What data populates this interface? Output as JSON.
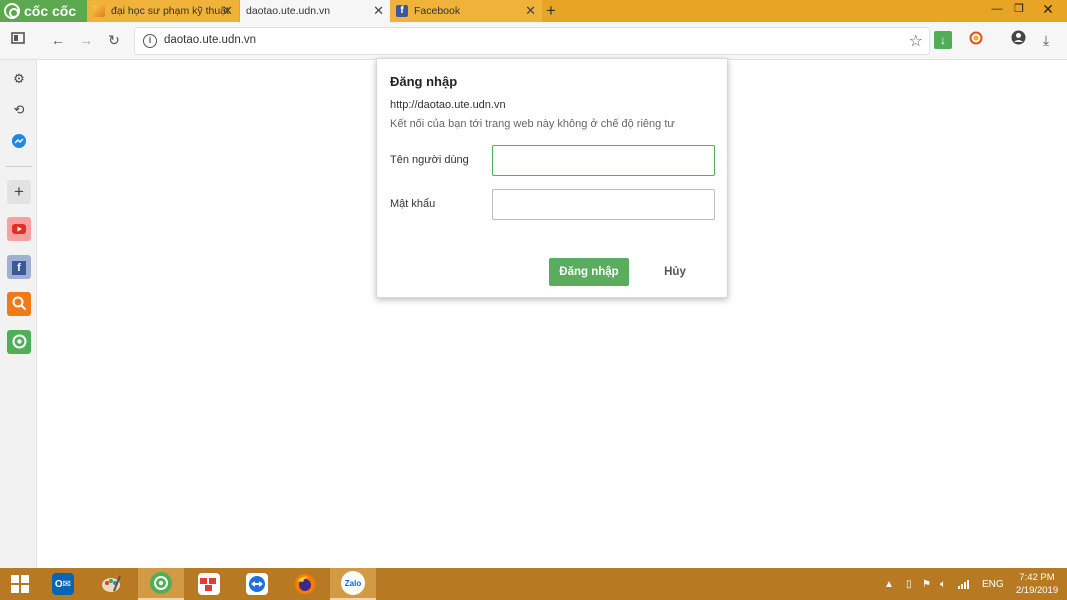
{
  "browser": {
    "brand": "cốc cốc",
    "tabs": [
      {
        "title": "đại học sư phạm kỹ thuật",
        "active": false,
        "favicon": "coccoc-leaf-icon"
      },
      {
        "title": "daotao.ute.udn.vn",
        "active": true,
        "favicon": ""
      },
      {
        "title": "Facebook",
        "active": false,
        "favicon": "facebook-icon"
      }
    ],
    "new_tab": "+",
    "address": "daotao.ute.udn.vn"
  },
  "sidebar": {
    "items": [
      "settings-icon",
      "history-icon",
      "messenger-icon",
      "add-icon",
      "youtube-icon",
      "facebook-icon",
      "search-icon",
      "coccoc-icon"
    ]
  },
  "dialog": {
    "title": "Đăng nhập",
    "url": "http://daotao.ute.udn.vn",
    "warning": "Kết nối của bạn tới trang web này không ở chế độ riêng tư",
    "username_label": "Tên người dùng",
    "username_value": "",
    "password_label": "Mật khẩu",
    "password_value": "",
    "login_button": "Đăng nhập",
    "cancel_button": "Hủy"
  },
  "taskbar": {
    "language": "ENG",
    "time": "7:42 PM",
    "date": "2/19/2019",
    "apps": [
      "windows-start-icon",
      "outlook-icon",
      "paint-icon",
      "coccoc-icon",
      "teamviewer-meeting-icon",
      "teamviewer-icon",
      "firefox-icon",
      "zalo-icon"
    ],
    "zalo_label": "Zalo"
  },
  "colors": {
    "tabstrip": "#e8a424",
    "brand_green": "#5ba84f",
    "button_green": "#5aad5e",
    "taskbar": "#b77a22"
  }
}
